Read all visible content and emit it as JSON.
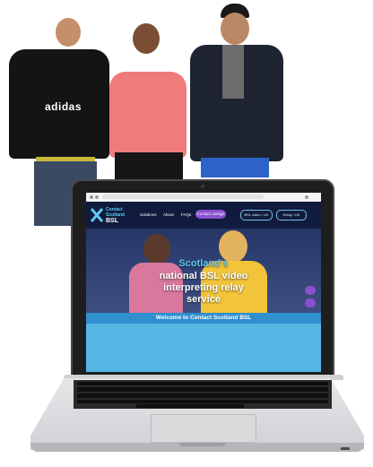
{
  "website": {
    "logo_line1": "Contact",
    "logo_line2": "Scotland",
    "logo_sub": "BSL",
    "nav_links": [
      "Solutions",
      "About",
      "FAQs"
    ],
    "nav_cta": "Contact us/sign",
    "nav_pills": [
      "BSL video / UK",
      "Relay / UK"
    ],
    "hero_line1": "Scotland's",
    "hero_line2": "national BSL video",
    "hero_line3": "interpreting relay",
    "hero_line4": "service",
    "banner": "Welcome to Contact Scotland BSL"
  },
  "photo": {
    "shirt_brand": "adidas"
  },
  "colors": {
    "accent_purple": "#8b4fd1",
    "brand_cyan": "#5ec8f2",
    "page_blue": "#56b7e4"
  }
}
